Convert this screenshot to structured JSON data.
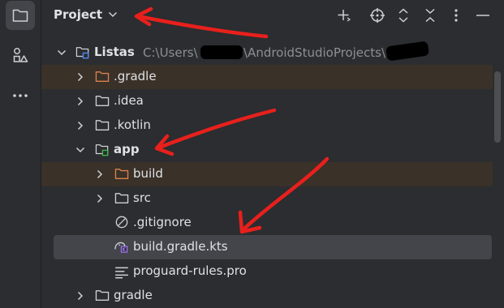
{
  "panel": {
    "title": "Project",
    "toolbar_icons": [
      "add-icon",
      "locate-icon",
      "expand-all-icon",
      "collapse-all-icon",
      "more-vertical-icon",
      "minimize-icon"
    ]
  },
  "stripe": {
    "icons": [
      "project-folder-icon",
      "structure-icon",
      "more-horizontal-icon"
    ]
  },
  "tree": {
    "root": {
      "label": "Listas",
      "path_prefix": "C:\\Users\\",
      "path_mid": "\\AndroidStudioProjects\\"
    },
    "items": [
      {
        "label": ".gradle",
        "icon": "folder-icon",
        "expanded": false
      },
      {
        "label": ".idea",
        "icon": "folder-icon",
        "expanded": false
      },
      {
        "label": ".kotlin",
        "icon": "folder-icon",
        "expanded": false
      },
      {
        "label": "app",
        "icon": "module-folder-icon",
        "expanded": true
      },
      {
        "label": "build",
        "icon": "folder-icon",
        "expanded": false
      },
      {
        "label": "src",
        "icon": "folder-icon",
        "expanded": false
      },
      {
        "label": ".gitignore",
        "icon": "ignore-file-icon"
      },
      {
        "label": "build.gradle.kts",
        "icon": "gradle-kotlin-file-icon"
      },
      {
        "label": "proguard-rules.pro",
        "icon": "text-file-icon"
      },
      {
        "label": "gradle",
        "icon": "folder-icon",
        "expanded": false
      }
    ]
  },
  "colors": {
    "background": "#2b2d30",
    "text": "#dfe1e5",
    "muted": "#8c8f94",
    "excluded_folder": "#d9824f",
    "excluded_row": "#3a3128",
    "selected_row": "#43454a",
    "module_badge": "#3fb950",
    "annotation": "#e8201c"
  }
}
